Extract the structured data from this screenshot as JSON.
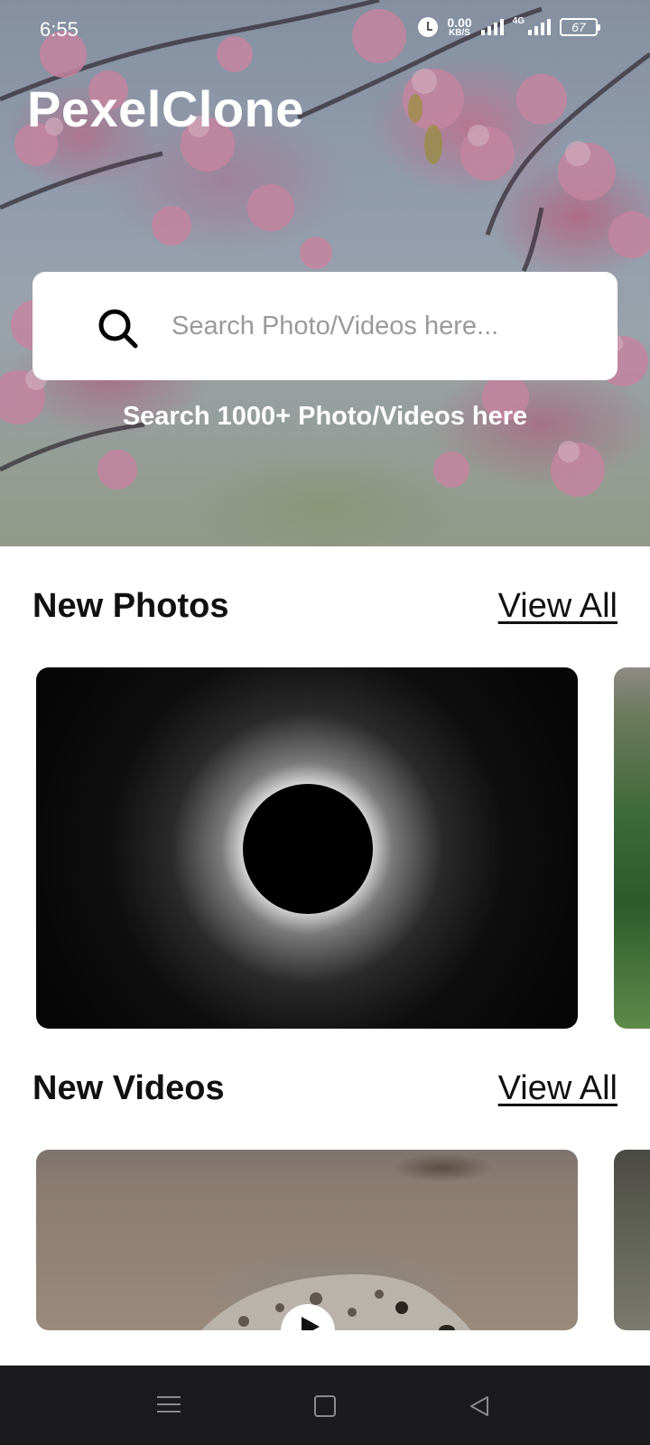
{
  "status_bar": {
    "time": "6:55",
    "net_speed_value": "0.00",
    "net_speed_unit": "KB/S",
    "network_type": "4G",
    "battery": "67"
  },
  "app": {
    "title": "PexelClone"
  },
  "search": {
    "placeholder": "Search Photo/Videos here...",
    "subtitle": "Search 1000+ Photo/Videos here"
  },
  "sections": {
    "photos": {
      "title": "New Photos",
      "view_all": "View All"
    },
    "videos": {
      "title": "New Videos",
      "view_all": "View All"
    }
  },
  "icons": {
    "search": "search-icon",
    "play": "play-icon",
    "nav_menu": "menu-icon",
    "nav_home": "home-icon",
    "nav_back": "back-icon"
  },
  "colors": {
    "nav_bar": "#1b1b1d",
    "card_background": "#ffffff",
    "text_primary": "#111111",
    "placeholder": "#9a9a9a"
  }
}
